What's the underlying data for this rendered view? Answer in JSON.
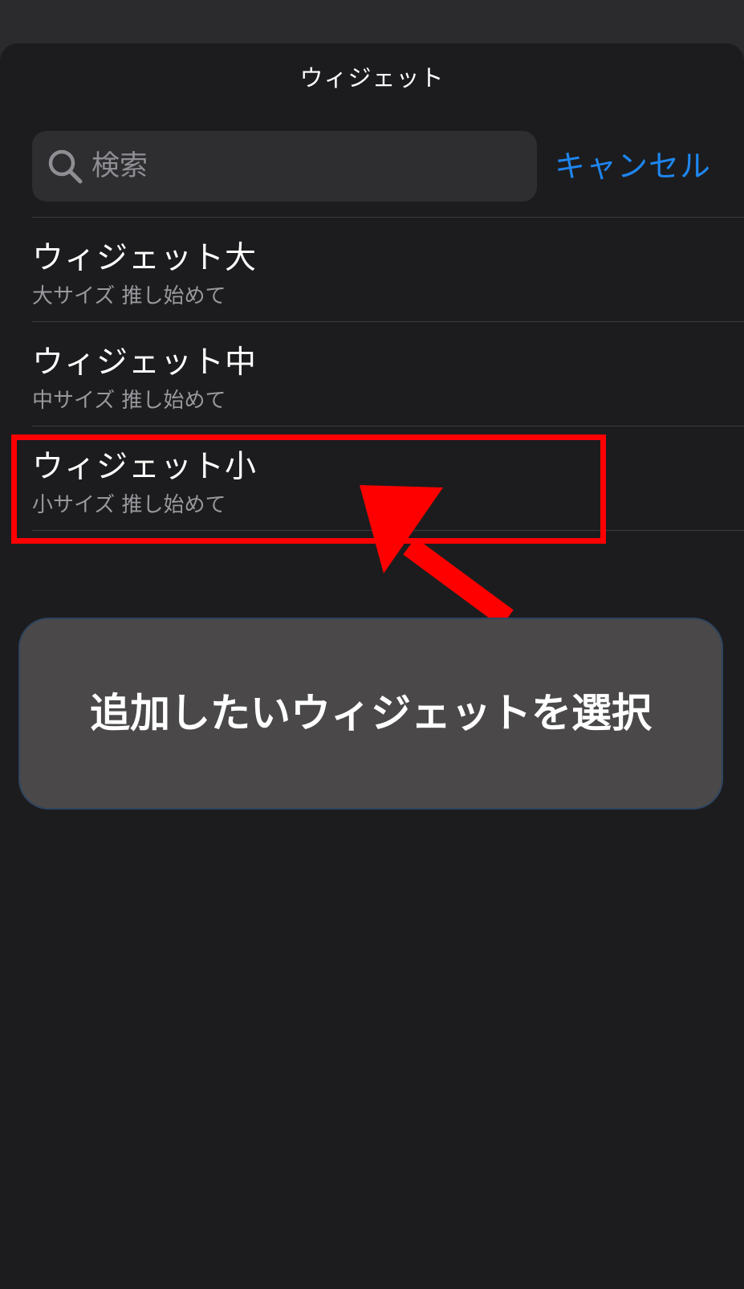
{
  "sheet": {
    "title": "ウィジェット"
  },
  "search": {
    "placeholder": "検索",
    "value": "",
    "icon": "search-icon"
  },
  "cancel_label": "キャンセル",
  "widgets": [
    {
      "title": "ウィジェット大",
      "subtitle": "大サイズ 推し始めて"
    },
    {
      "title": "ウィジェット中",
      "subtitle": "中サイズ 推し始めて"
    },
    {
      "title": "ウィジェット小",
      "subtitle": "小サイズ 推し始めて"
    }
  ],
  "annotation": {
    "callout_text": "追加したいウィジェットを選択",
    "highlight_color": "#ff0000",
    "arrow_color": "#ff0000"
  },
  "colors": {
    "accent": "#1e86f0",
    "sheet_background": "#1c1c1e",
    "search_background": "#2e2e31",
    "callout_background": "#4a4849"
  }
}
